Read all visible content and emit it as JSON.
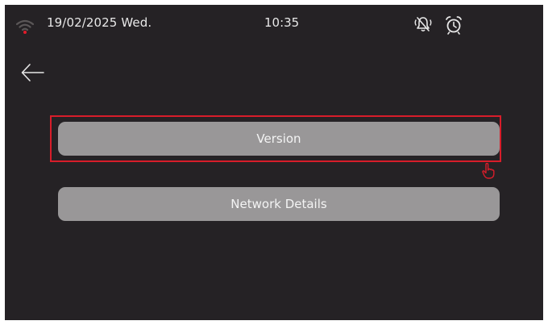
{
  "status_bar": {
    "date": "19/02/2025 Wed.",
    "time": "10:35",
    "wifi_icon": "wifi-icon",
    "mute_icon": "bell-muted-icon",
    "alarm_icon": "alarm-clock-icon",
    "wifi_color": "#e21b2a"
  },
  "navigation": {
    "back_icon": "arrow-left-icon"
  },
  "menu": {
    "items": [
      {
        "label": "Version",
        "highlighted": true
      },
      {
        "label": "Network Details",
        "highlighted": false
      }
    ]
  },
  "annotation": {
    "highlight_color": "#d81d2a",
    "pointer_icon": "hand-pointer-icon"
  },
  "colors": {
    "background": "#252225",
    "button": "#999798",
    "text": "#e8e8e8"
  }
}
